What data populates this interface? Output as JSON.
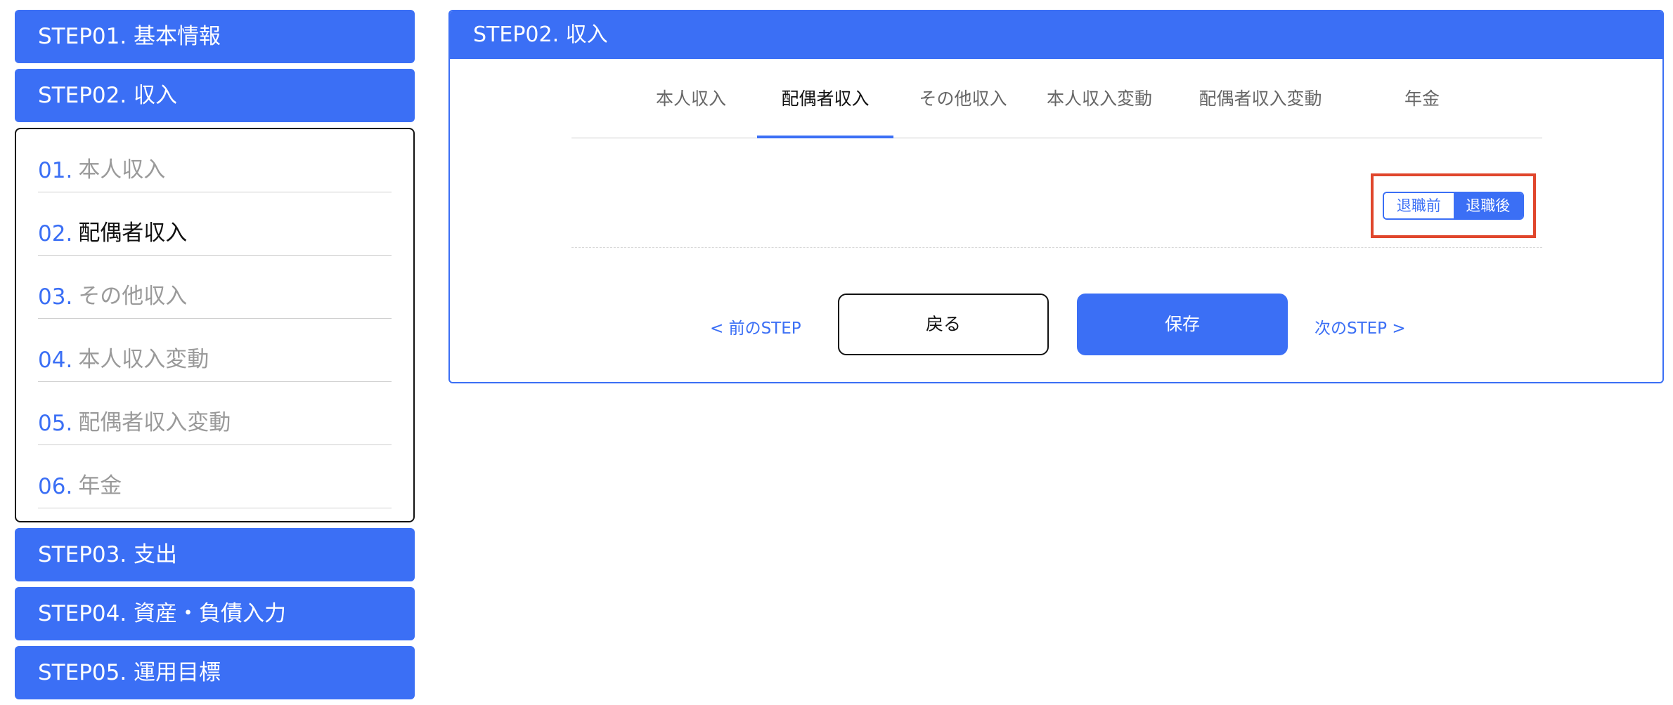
{
  "sidebar": {
    "steps_top": [
      {
        "label": "STEP01. 基本情報"
      },
      {
        "label": "STEP02. 収入"
      }
    ],
    "substeps": [
      {
        "num": "01.",
        "label": "本人収入"
      },
      {
        "num": "02.",
        "label": "配偶者収入"
      },
      {
        "num": "03.",
        "label": "その他収入"
      },
      {
        "num": "04.",
        "label": "本人収入変動"
      },
      {
        "num": "05.",
        "label": "配偶者収入変動"
      },
      {
        "num": "06.",
        "label": "年金"
      }
    ],
    "steps_bottom": [
      {
        "label": "STEP03. 支出"
      },
      {
        "label": "STEP04. 資産・負債入力"
      },
      {
        "label": "STEP05. 運用目標"
      }
    ]
  },
  "main": {
    "title": "STEP02. 収入",
    "tabs": [
      {
        "label": "本人収入"
      },
      {
        "label": "配偶者収入"
      },
      {
        "label": "その他収入"
      },
      {
        "label": "本人収入変動"
      },
      {
        "label": "配偶者収入変動"
      },
      {
        "label": "年金"
      }
    ],
    "toggle": {
      "options": [
        "退職前",
        "退職後"
      ],
      "selected": "退職後"
    },
    "nav": {
      "prev": "< 前のSTEP",
      "back": "戻る",
      "save": "保存",
      "next": "次のSTEP >"
    }
  },
  "colors": {
    "accent": "#3b6ff5",
    "highlight": "#e0462c"
  }
}
